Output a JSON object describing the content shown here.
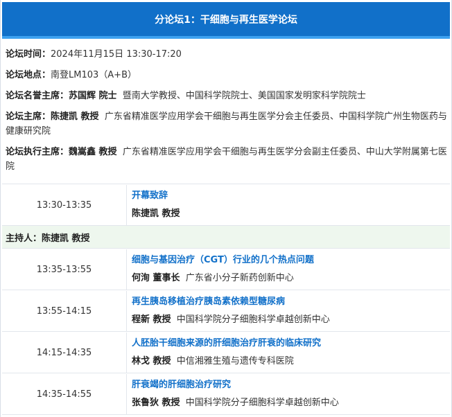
{
  "header": {
    "title": "分论坛1：干细胞与再生医学论坛"
  },
  "info": {
    "time_label": "论坛时间：",
    "time_value": "2024年11月15日 13:30-17:20",
    "venue_label": "论坛地点：",
    "venue_value": "南登LM103（A+B）",
    "honorary_label": "论坛名誉主席：",
    "honorary_name": "苏国辉 院士",
    "honorary_desc": "暨南大学教授、中国科学院院士、美国国家发明家科学院院士",
    "chair_label": "论坛主席：",
    "chair_name": "陈捷凯 教授",
    "chair_desc": "广东省精准医学应用学会干细胞与再生医学分会主任委员、中国科学院广州生物医药与健康研究院",
    "exec_label": "论坛执行主席：",
    "exec_name": "魏嵩鑫 教授",
    "exec_desc": "广东省精准医学应用学会干细胞与再生医学分会副主任委员、中山大学附属第七医院"
  },
  "opening": {
    "time": "13:30-13:35",
    "title": "开幕致辞",
    "speaker_name": "陈捷凯 教授",
    "speaker_org": ""
  },
  "moderator": {
    "text": "主持人：陈捷凯 教授"
  },
  "sessions": [
    {
      "time": "13:35-13:55",
      "title": "细胞与基因治疗（CGT）行业的几个热点问题",
      "speaker_name": "何洵 董事长",
      "speaker_org": "广东省小分子新药创新中心"
    },
    {
      "time": "13:55-14:15",
      "title": "再生胰岛移植治疗胰岛素依赖型糖尿病",
      "speaker_name": "程新 教授",
      "speaker_org": "中国科学院分子细胞科学卓越创新中心"
    },
    {
      "time": "14:15-14:35",
      "title": "人胚胎干细胞来源的肝细胞治疗肝衰的临床研究",
      "speaker_name": "林戈 教授",
      "speaker_org": "中信湘雅生殖与遗传专科医院"
    },
    {
      "time": "14:35-14:55",
      "title": "肝衰竭的肝细胞治疗研究",
      "speaker_name": "张鲁狄 教授",
      "speaker_org": "中国科学院分子细胞科学卓越创新中心"
    }
  ]
}
